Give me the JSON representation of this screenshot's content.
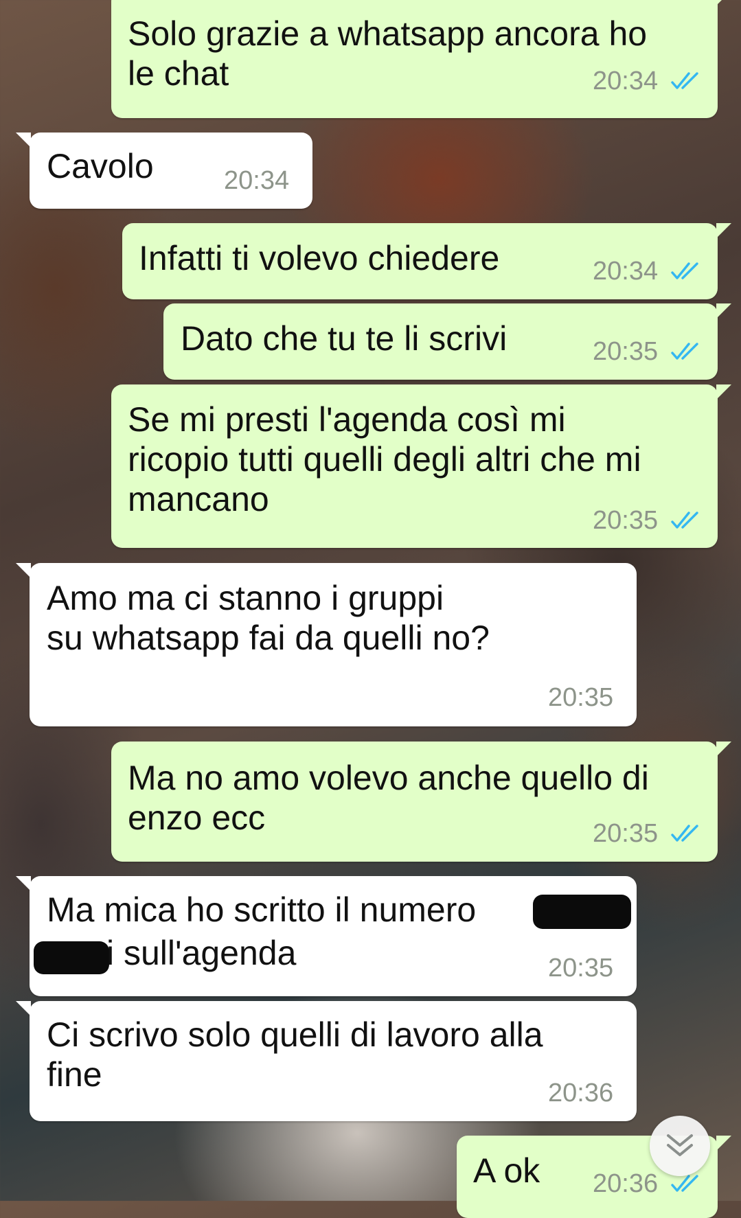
{
  "chat": {
    "messages": [
      {
        "direction": "outgoing",
        "text": "Solo grazie a whatsapp ancora ho\nle chat",
        "time": "20:34",
        "status": "read"
      },
      {
        "direction": "incoming",
        "text": "Cavolo",
        "time": "20:34"
      },
      {
        "direction": "outgoing",
        "text": "Infatti ti volevo chiedere",
        "time": "20:34",
        "status": "read"
      },
      {
        "direction": "outgoing",
        "text": "Dato che tu te li scrivi",
        "time": "20:35",
        "status": "read"
      },
      {
        "direction": "outgoing",
        "text": "Se mi presti l'agenda così mi\nricopio tutti quelli degli altri che mi\nmancano",
        "time": "20:35",
        "status": "read"
      },
      {
        "direction": "incoming",
        "text": "Amo ma ci stanno i gruppi\nsu whatsapp fai da quelli no?",
        "time": "20:35"
      },
      {
        "direction": "outgoing",
        "text": "Ma no amo volevo anche quello di\nenzo ecc",
        "time": "20:35",
        "status": "read"
      },
      {
        "direction": "incoming",
        "text_line1": "Ma mica ho scritto il numero",
        "text_line2": "i sull'agenda",
        "time": "20:35",
        "redacted": true
      },
      {
        "direction": "incoming",
        "text": "Ci scrivo solo quelli di lavoro alla\nfine",
        "time": "20:36"
      },
      {
        "direction": "outgoing",
        "text": "A ok",
        "time": "20:36",
        "status": "read"
      }
    ]
  },
  "colors": {
    "outgoing_bubble": "#e2ffc8",
    "incoming_bubble": "#ffffff",
    "read_ticks": "#34b7f1",
    "timestamp": "#8d948a"
  },
  "icons": {
    "read_status": "double-check-icon",
    "scroll_down": "chevron-double-down-icon"
  }
}
